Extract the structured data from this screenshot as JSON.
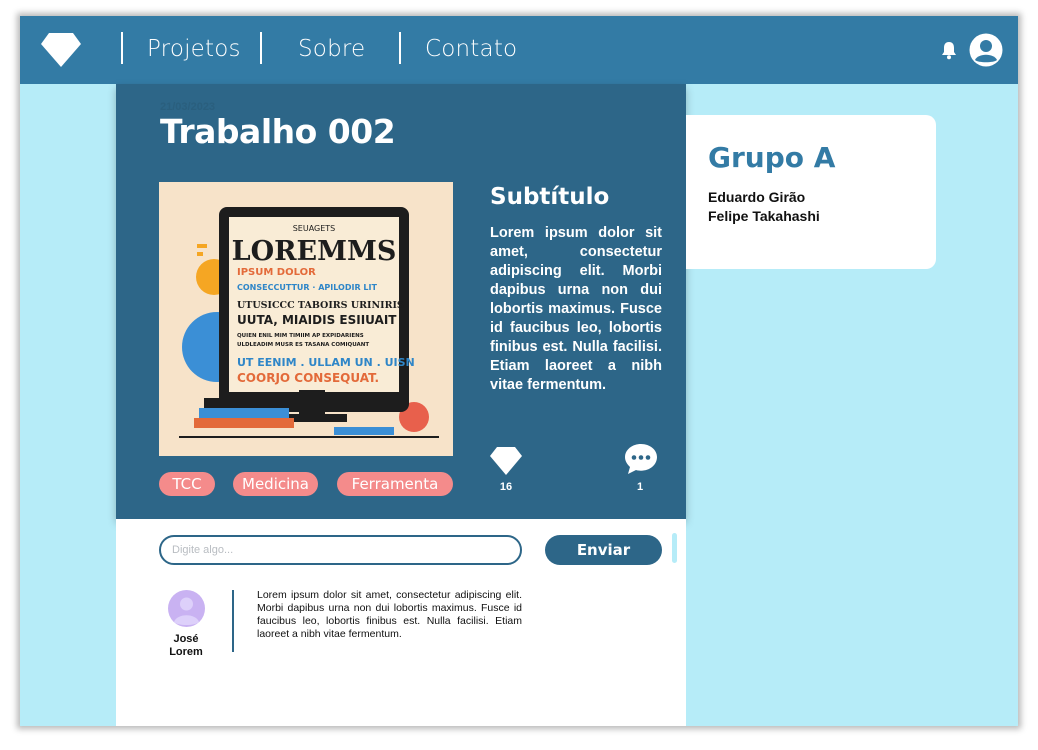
{
  "nav": {
    "items": [
      {
        "label": "Projetos"
      },
      {
        "label": "Sobre"
      },
      {
        "label": "Contato"
      }
    ],
    "logo_icon": "diamond-icon",
    "bell_icon": "bell-icon",
    "user_icon": "user-circle-icon"
  },
  "post": {
    "date": "21/03/2023",
    "title": "Trabalho 002",
    "image": {
      "heading": "LOREMMS",
      "caption_top": "SEUAGETS",
      "lines": [
        "IPSUM DOLOR",
        "CONSECCUTTUR · APILODIR LIT",
        "UTUSICCC TABOIRS URINIRIS",
        "UUTA, MIAIDIS ESIIUAIT",
        "QUIEN ENIL MIM TIMIIM AP EXPIDARIENS",
        "ULDLEADIM MUSR ES TASANA COMIQUANT",
        "UT EENIM . ULLAM UN . UISN",
        "COORJO CONSEQUAT."
      ]
    },
    "subtitle": "Subtítulo",
    "body": "Lorem ipsum dolor sit amet, consectetur adipiscing elit. Morbi dapibus urna non dui lobortis maximus. Fusce id faucibus leo, lobortis finibus est. Nulla facilisi. Etiam laoreet a nibh vitae fermentum.",
    "tags": [
      "TCC",
      "Medicina",
      "Ferramenta"
    ],
    "likes": "16",
    "comments": "1"
  },
  "group": {
    "title": "Grupo A",
    "members": [
      "Eduardo Girão",
      "Felipe Takahashi"
    ]
  },
  "comment_form": {
    "placeholder": "Digite algo...",
    "send_label": "Enviar"
  },
  "comments_list": [
    {
      "name": "José Lorem",
      "text": "Lorem ipsum dolor sit amet, consectetur adipiscing elit. Morbi dapibus urna non dui lobortis maximus. Fusce id faucibus leo, lobortis finibus est. Nulla facilisi. Etiam laoreet a nibh vitae fermentum."
    }
  ],
  "colors": {
    "topbar": "#337ba5",
    "post_bg": "#2d6688",
    "page_bg": "#b6ecf8",
    "tag": "#f48b8b",
    "avatar": "#c9b2f2"
  }
}
